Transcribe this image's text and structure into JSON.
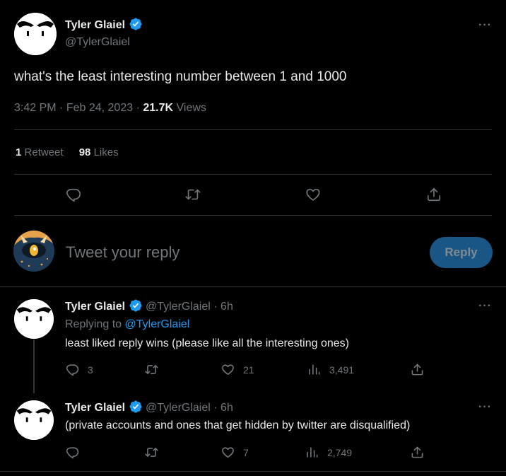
{
  "main_tweet": {
    "author_name": "Tyler Glaiel",
    "author_handle": "@TylerGlaiel",
    "text": "what's the least interesting number between 1 and 1000",
    "time": "3:42 PM",
    "date": "Feb 24, 2023",
    "sep1": "·",
    "sep2": "·",
    "views_count": "21.7K",
    "views_label": "Views",
    "retweet_count": "1",
    "retweet_label": "Retweet",
    "likes_count": "98",
    "likes_label": "Likes",
    "more": "···"
  },
  "compose": {
    "placeholder": "Tweet your reply",
    "button_label": "Reply"
  },
  "replies": [
    {
      "author_name": "Tyler Glaiel",
      "author_handle": "@TylerGlaiel",
      "sep": "·",
      "time": "6h",
      "replying_prefix": "Replying to",
      "replying_to": "@TylerGlaiel",
      "text": "least liked reply wins (please like all the interesting ones)",
      "reply_count": "3",
      "retweet_count": "",
      "like_count": "21",
      "view_count": "3,491",
      "more": "···"
    },
    {
      "author_name": "Tyler Glaiel",
      "author_handle": "@TylerGlaiel",
      "sep": "·",
      "time": "6h",
      "text": "(private accounts and ones that get hidden by twitter are disqualified)",
      "reply_count": "",
      "retweet_count": "",
      "like_count": "7",
      "view_count": "2,749",
      "more": "···"
    }
  ],
  "colors": {
    "background": "#000000",
    "text": "#e7e9ea",
    "muted": "#71767b",
    "accent": "#1d9bf0",
    "reply_button": "#1a5685",
    "divider": "#2f3336"
  },
  "icons": [
    "verified-badge-icon",
    "more-icon",
    "reply-icon",
    "retweet-icon",
    "like-icon",
    "share-icon",
    "views-icon"
  ]
}
